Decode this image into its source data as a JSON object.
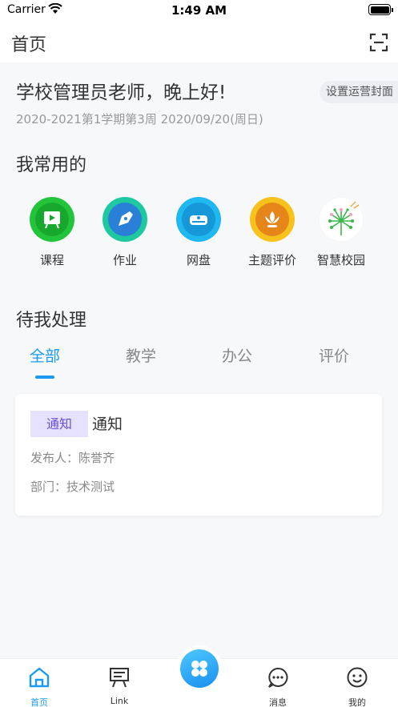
{
  "status": {
    "carrier": "Carrier",
    "time": "1:49 AM"
  },
  "nav": {
    "title": "首页"
  },
  "greeting": "学校管理员老师，晚上好!",
  "cover_button": "设置运营封面",
  "term": "2020-2021第1学期第3周 2020/09/20(周日)",
  "frequent": {
    "title": "我常用的",
    "apps": [
      {
        "label": "课程",
        "icon": "course-icon",
        "color": "#22c43a"
      },
      {
        "label": "作业",
        "icon": "homework-icon",
        "color": "#1ec9a0"
      },
      {
        "label": "网盘",
        "icon": "cloud-drive-icon",
        "color": "#1fb8f0"
      },
      {
        "label": "主题评价",
        "icon": "theme-evaluation-icon",
        "color": "#f7c21b"
      },
      {
        "label": "智慧校园",
        "icon": "smart-campus-icon",
        "color": "#f5f5f5"
      }
    ]
  },
  "todo": {
    "title": "待我处理",
    "tabs": [
      "全部",
      "教学",
      "办公",
      "评价"
    ],
    "active_tab": "全部",
    "card": {
      "badge": "通知",
      "title": "通知",
      "publisher": "发布人：陈誉齐",
      "department": "部门：技术测试"
    }
  },
  "tabbar": {
    "items": [
      {
        "label": "首页",
        "icon": "home-icon"
      },
      {
        "label": "Link",
        "icon": "link-board-icon"
      },
      {
        "label": "消息",
        "icon": "message-icon"
      },
      {
        "label": "我的",
        "icon": "profile-icon"
      }
    ],
    "center_icon": "apps-grid-icon",
    "accent": "#1a9af0"
  }
}
